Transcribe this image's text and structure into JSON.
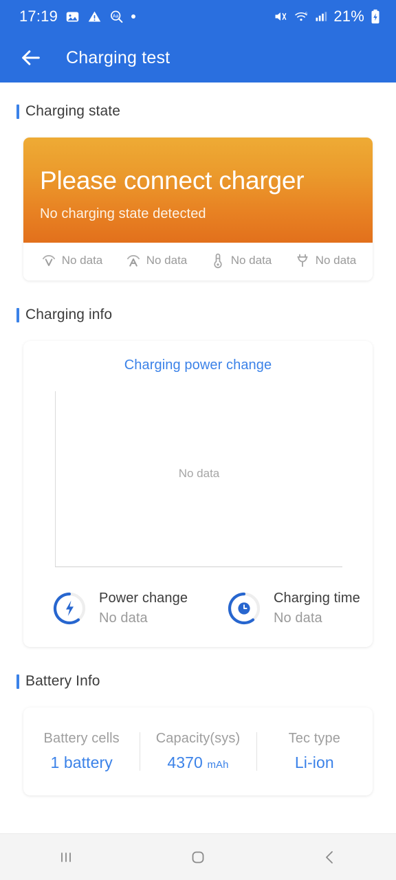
{
  "statusbar": {
    "time": "17:19",
    "battery_percent": "21%",
    "left_icons": [
      "image-icon",
      "warning-triangle-icon",
      "translate-search-icon",
      "dot-indicator-icon"
    ],
    "right_icons": [
      "mute-icon",
      "wifi-icon",
      "signal-bars-icon",
      "battery-charging-icon"
    ]
  },
  "appbar": {
    "title": "Charging test",
    "back_icon": "back-arrow-icon"
  },
  "sections": {
    "charging_state": {
      "title": "Charging state"
    },
    "charging_info": {
      "title": "Charging info"
    },
    "battery_info": {
      "title": "Battery Info"
    }
  },
  "charging_state": {
    "headline": "Please connect charger",
    "subtitle": "No charging state detected",
    "metrics": [
      {
        "icon": "voltage-icon",
        "label": "No data"
      },
      {
        "icon": "amperage-icon",
        "label": "No data"
      },
      {
        "icon": "thermometer-icon",
        "label": "No data"
      },
      {
        "icon": "plug-icon",
        "label": "No data"
      }
    ]
  },
  "charging_info": {
    "chart_title": "Charging power change",
    "chart_empty_text": "No data",
    "stats": [
      {
        "icon": "power-bolt-ring-icon",
        "name": "Power change",
        "value": "No data"
      },
      {
        "icon": "clock-ring-icon",
        "name": "Charging time",
        "value": "No data"
      }
    ]
  },
  "battery_info": {
    "columns": [
      {
        "label": "Battery cells",
        "value": "1 battery",
        "unit": ""
      },
      {
        "label": "Capacity(sys)",
        "value": "4370",
        "unit": "mAh"
      },
      {
        "label": "Tec type",
        "value": "Li-ion",
        "unit": ""
      }
    ]
  },
  "navbar": {
    "recents_label": "recents-icon",
    "home_label": "home-icon",
    "back_label": "back-icon"
  },
  "chart_data": {
    "type": "line",
    "title": "Charging power change",
    "series": [],
    "x": [],
    "values": [],
    "xlabel": "",
    "ylabel": "",
    "grid": false,
    "legend": "none",
    "empty_state": "No data"
  },
  "colors": {
    "brand_blue": "#2a6fdf",
    "accent_blue": "#3b82e8",
    "gradient_top": "#eeab35",
    "gradient_bottom": "#e2701c",
    "muted_text": "#9a9a9a"
  }
}
